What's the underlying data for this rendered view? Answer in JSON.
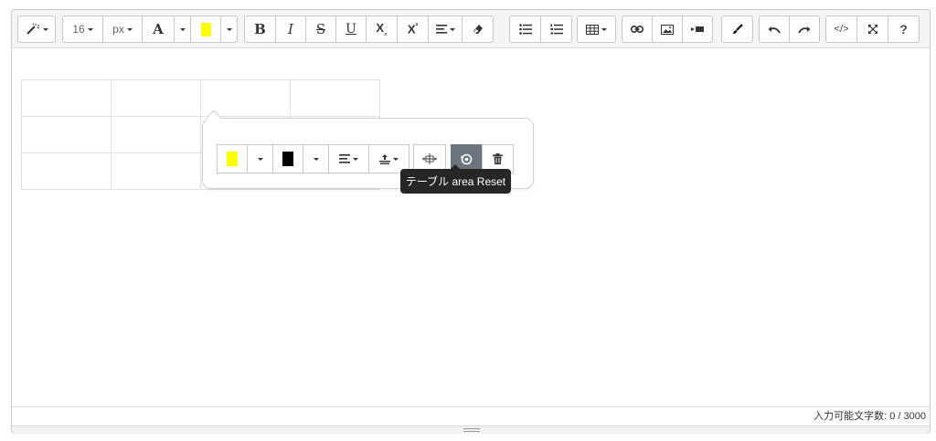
{
  "toolbar": {
    "font_size": "16",
    "font_unit": "px",
    "bold": "B",
    "italic": "I",
    "strike": "S",
    "underline": "U",
    "subscript": "X",
    "subscript_mark": "₂",
    "superscript": "X",
    "superscript_mark": "²",
    "font_color_glyph": "A",
    "code_view": "</>",
    "help": "?",
    "highlight_color": "#ffff00"
  },
  "table_popover": {
    "cell_bg_color": "#ffff00",
    "text_color": "#000000"
  },
  "tooltip": {
    "text": "テーブル area Reset"
  },
  "status": {
    "char_count": "入力可能文字数: 0 / 3000"
  }
}
